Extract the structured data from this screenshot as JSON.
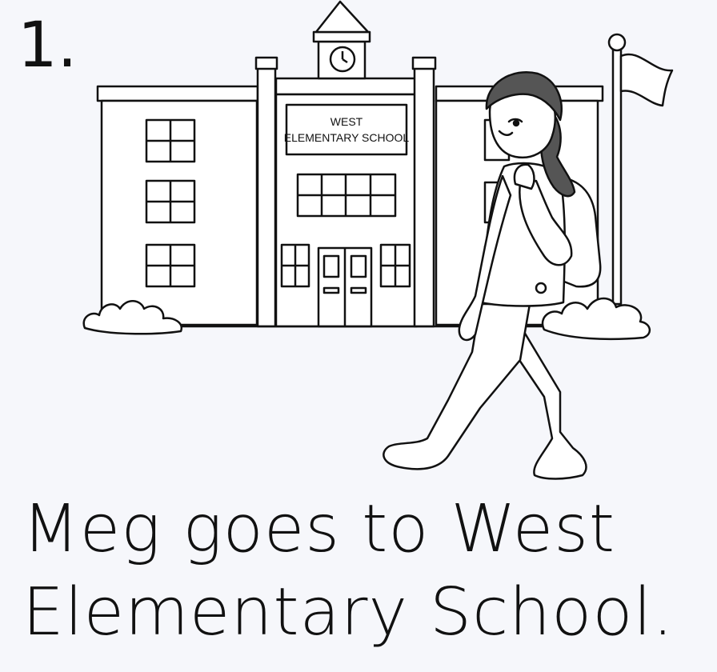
{
  "page": {
    "number": "1.",
    "sign": {
      "line1": "WEST",
      "line2": "ELEMENTARY SCHOOL"
    },
    "caption": {
      "line1": "Meg goes to West",
      "line2": "Elementary School."
    }
  },
  "colors": {
    "background": "#f6f7fb",
    "ink": "#111111"
  },
  "icons": [
    "school-building",
    "clock-icon",
    "flag-icon",
    "bush",
    "girl-with-backpack"
  ]
}
